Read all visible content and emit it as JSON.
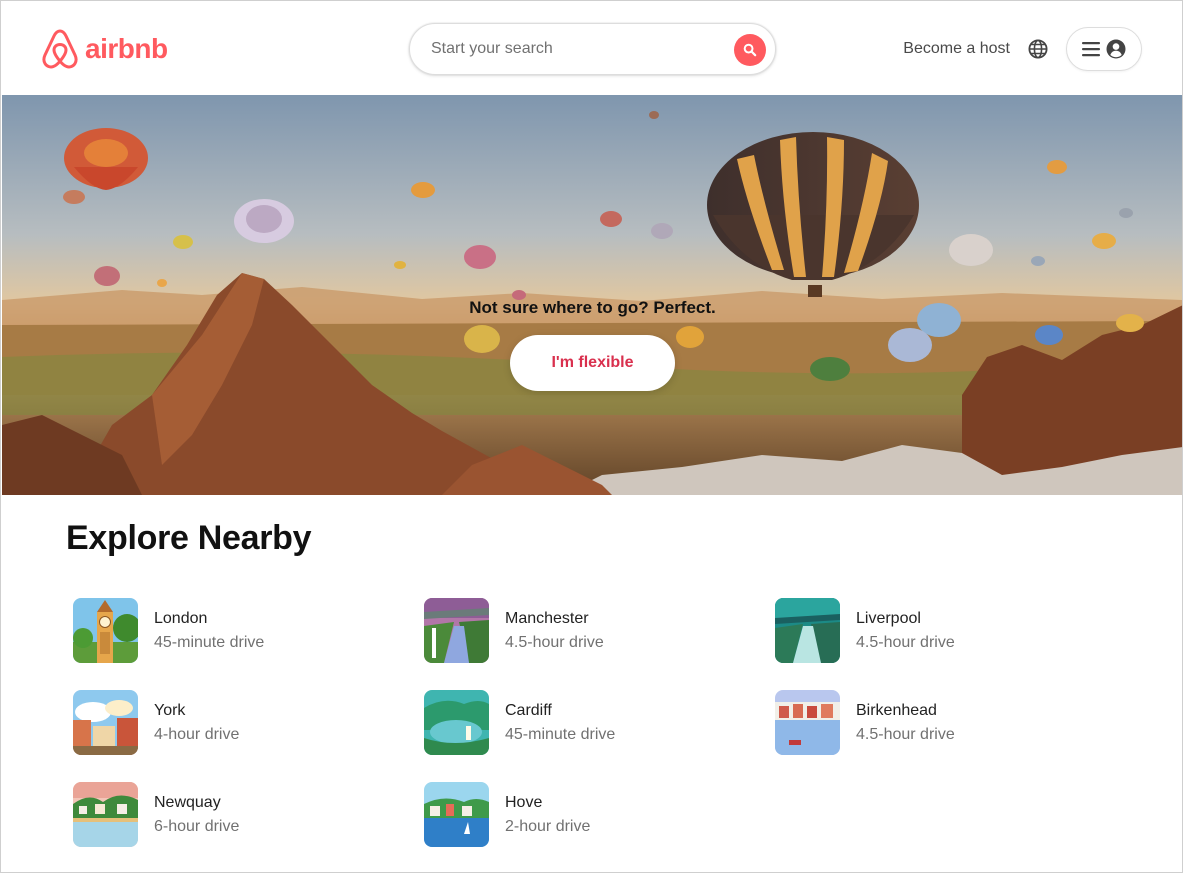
{
  "header": {
    "logo_text": "airbnb",
    "search_placeholder": "Start your search",
    "become_host": "Become a host",
    "icons": {
      "search": "search-icon",
      "globe": "globe-icon",
      "menu": "menu-icon",
      "account": "account-icon"
    },
    "brand_color": "#ff5a5f"
  },
  "hero": {
    "tagline": "Not sure where to go? Perfect.",
    "flexible_button": "I'm flexible",
    "button_text_color": "#d9304e"
  },
  "explore": {
    "title": "Explore Nearby",
    "places": [
      {
        "city": "London",
        "drive": "45-minute drive"
      },
      {
        "city": "Manchester",
        "drive": "4.5-hour drive"
      },
      {
        "city": "Liverpool",
        "drive": "4.5-hour drive"
      },
      {
        "city": "York",
        "drive": "4-hour drive"
      },
      {
        "city": "Cardiff",
        "drive": "45-minute drive"
      },
      {
        "city": "Birkenhead",
        "drive": "4.5-hour drive"
      },
      {
        "city": "Newquay",
        "drive": "6-hour drive"
      },
      {
        "city": "Hove",
        "drive": "2-hour drive"
      }
    ]
  }
}
